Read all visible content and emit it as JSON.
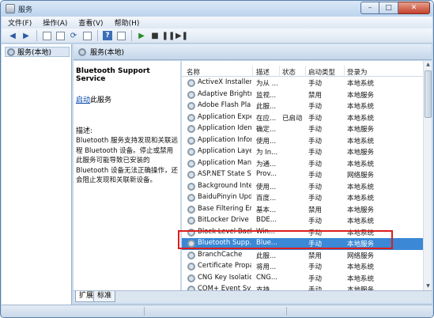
{
  "window": {
    "title": "服务"
  },
  "window_buttons": {
    "minimize": "–",
    "maximize": "□",
    "close": "✕"
  },
  "menu": [
    {
      "label": "文件(F)"
    },
    {
      "label": "操作(A)"
    },
    {
      "label": "查看(V)"
    },
    {
      "label": "帮助(H)"
    }
  ],
  "toolbar": {
    "icons": [
      "back-arrow-icon",
      "forward-arrow-icon",
      "console-tree-icon",
      "properties-icon",
      "refresh-icon",
      "export-icon",
      "help-icon",
      "play-icon",
      "stop-icon",
      "pause-icon",
      "restart-icon"
    ],
    "help_label": "?"
  },
  "tree": {
    "root_label": "服务(本地)"
  },
  "panel": {
    "header": "服务(本地)"
  },
  "details": {
    "service_name": "Bluetooth Support Service",
    "start_link": "启动",
    "start_suffix": "此服务",
    "desc_label": "描述:",
    "desc_text": "Bluetooth 服务支持发现和关联远程 Bluetooth 设备。停止或禁用此服务可能导致已安装的 Bluetooth 设备无法正确操作，还会阻止发现和关联新设备。"
  },
  "columns": {
    "name": "名称",
    "desc": "描述",
    "status": "状态",
    "startup": "启动类型",
    "logon": "登录为"
  },
  "services": [
    {
      "name": "ActiveX Installer ...",
      "desc": "为从 ...",
      "status": "",
      "startup": "手动",
      "logon": "本地系统"
    },
    {
      "name": "Adaptive Brightn...",
      "desc": "监视...",
      "status": "",
      "startup": "禁用",
      "logon": "本地服务"
    },
    {
      "name": "Adobe Flash Pla...",
      "desc": "此服...",
      "status": "",
      "startup": "手动",
      "logon": "本地系统"
    },
    {
      "name": "Application Expe...",
      "desc": "在应...",
      "status": "已启动",
      "startup": "手动",
      "logon": "本地系统"
    },
    {
      "name": "Application Iden...",
      "desc": "确定...",
      "status": "",
      "startup": "手动",
      "logon": "本地服务"
    },
    {
      "name": "Application Infor...",
      "desc": "使用...",
      "status": "",
      "startup": "手动",
      "logon": "本地系统"
    },
    {
      "name": "Application Laye...",
      "desc": "为 In...",
      "status": "",
      "startup": "手动",
      "logon": "本地服务"
    },
    {
      "name": "Application Man...",
      "desc": "为通...",
      "status": "",
      "startup": "手动",
      "logon": "本地系统"
    },
    {
      "name": "ASP.NET State S...",
      "desc": "Prov...",
      "status": "",
      "startup": "手动",
      "logon": "网络服务"
    },
    {
      "name": "Background Inte...",
      "desc": "使用...",
      "status": "",
      "startup": "手动",
      "logon": "本地系统"
    },
    {
      "name": "BaiduPinyin Upd...",
      "desc": "百度...",
      "status": "",
      "startup": "手动",
      "logon": "本地系统"
    },
    {
      "name": "Base Filtering En...",
      "desc": "基本...",
      "status": "",
      "startup": "禁用",
      "logon": "本地服务"
    },
    {
      "name": "BitLocker Drive ...",
      "desc": "BDE...",
      "status": "",
      "startup": "手动",
      "logon": "本地系统"
    },
    {
      "name": "Block Level Back...",
      "desc": "Win...",
      "status": "",
      "startup": "手动",
      "logon": "本地系统"
    },
    {
      "name": "Bluetooth Supp...",
      "desc": "Blue...",
      "status": "",
      "startup": "手动",
      "logon": "本地服务",
      "selected": true
    },
    {
      "name": "BranchCache",
      "desc": "此服...",
      "status": "",
      "startup": "禁用",
      "logon": "网络服务"
    },
    {
      "name": "Certificate Propa...",
      "desc": "将用...",
      "status": "",
      "startup": "手动",
      "logon": "本地系统"
    },
    {
      "name": "CNG Key Isolation",
      "desc": "CNG...",
      "status": "",
      "startup": "手动",
      "logon": "本地系统"
    },
    {
      "name": "COM+ Event Sys...",
      "desc": "支持...",
      "status": "",
      "startup": "手动",
      "logon": "本地服务"
    }
  ],
  "tabs": [
    {
      "label": "扩展"
    },
    {
      "label": "标准"
    }
  ]
}
